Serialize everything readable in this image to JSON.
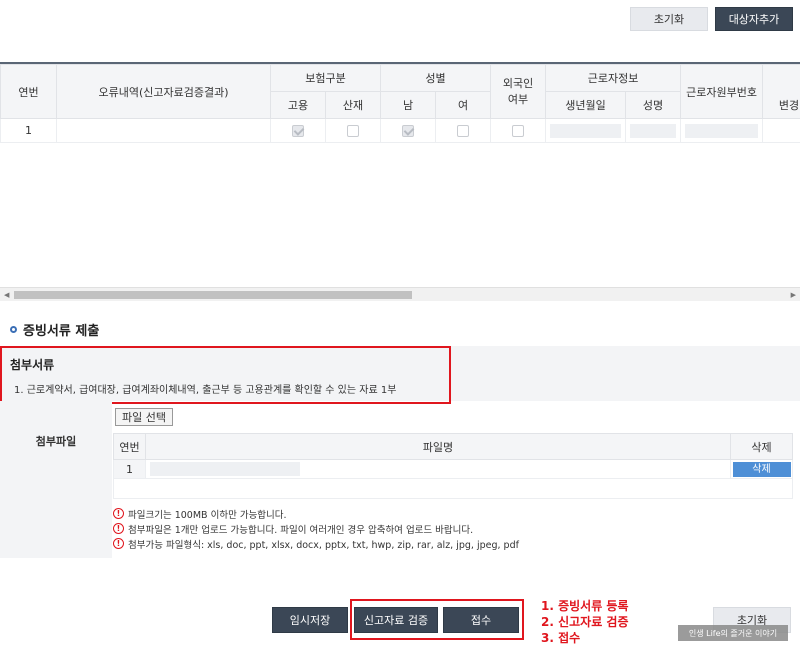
{
  "top_buttons": {
    "reset": "초기화",
    "add_target": "대상자추가"
  },
  "grid": {
    "headers": {
      "seq": "연번",
      "error": "오류내역(신고자료검증결과)",
      "insurance": "보험구분",
      "insurance_employ": "고용",
      "insurance_industrial": "산재",
      "gender": "성별",
      "gender_male": "남",
      "gender_female": "여",
      "foreigner": "외국인\n여부",
      "worker_info": "근로자정보",
      "birth": "생년월일",
      "name": "성명",
      "worker_rrn": "근로자원부번호",
      "change": "변경"
    },
    "rows": [
      {
        "seq": "1",
        "employ_checked": true,
        "industrial_checked": false,
        "male_checked": true,
        "female_checked": false,
        "foreigner_checked": false
      }
    ]
  },
  "section_title": "증빙서류 제출",
  "notice": {
    "title": "첨부서류",
    "text": "1. 근로계약서, 급여대장, 급여계좌이체내역, 출근부 등 고용관계를 확인할 수 있는 자료 1부"
  },
  "attachment": {
    "label": "첨부파일",
    "select_button": "파일 선택",
    "headers": {
      "seq": "연번",
      "filename": "파일명",
      "delete": "삭제"
    },
    "rows": [
      {
        "seq": "1",
        "delete": "삭제"
      }
    ],
    "notes": [
      "파일크기는 100MB 이하만 가능합니다.",
      "첨부파일은 1개만 업로드 가능합니다. 파일이 여러개인 경우 압축하여 업로드 바랍니다.",
      "첨부가능 파일형식: xls, doc, ppt, xlsx, docx, pptx, txt, hwp, zip, rar, alz, jpg, jpeg, pdf"
    ]
  },
  "bottom_buttons": {
    "temp_save": "임시저장",
    "validate": "신고자료 검증",
    "submit": "접수",
    "reset": "초기화"
  },
  "steps": [
    "1. 증빙서류 등록",
    "2. 신고자료 검증",
    "3. 접수"
  ],
  "watermark": "인생 Life의 즐거운 이야기",
  "colors": {
    "highlight": "#e0161e",
    "dark_button": "#3b4756",
    "delete_button": "#4e8fd6"
  }
}
